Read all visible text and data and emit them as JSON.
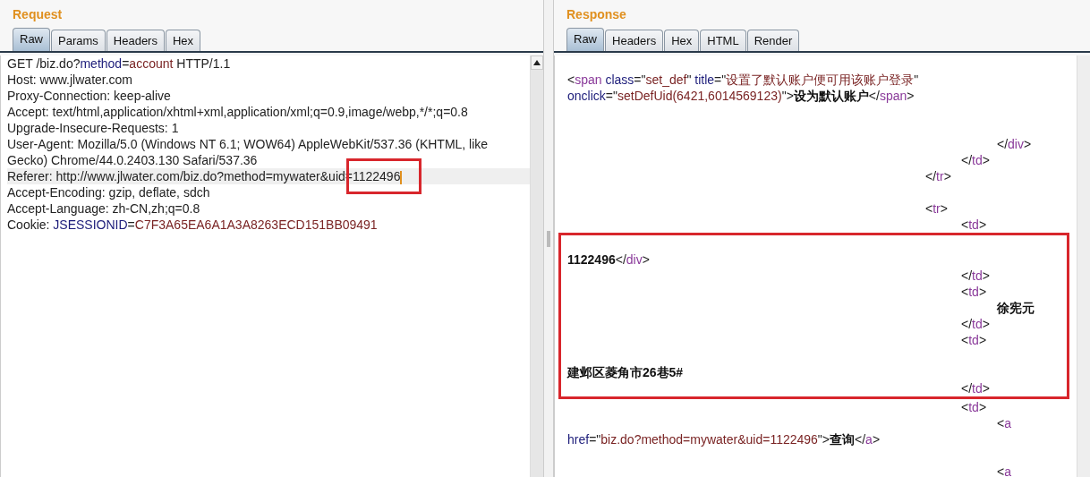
{
  "request": {
    "title": "Request",
    "tabs": [
      {
        "label": "Raw",
        "selected": true
      },
      {
        "label": "Params",
        "selected": false
      },
      {
        "label": "Headers",
        "selected": false
      },
      {
        "label": "Hex",
        "selected": false
      }
    ],
    "lines": [
      {
        "segments": [
          {
            "kind": "plain",
            "text": "GET /biz.do?"
          },
          {
            "kind": "name",
            "text": "method"
          },
          {
            "kind": "plain",
            "text": "="
          },
          {
            "kind": "value",
            "text": "account"
          },
          {
            "kind": "plain",
            "text": " HTTP/1.1"
          }
        ]
      },
      {
        "segments": [
          {
            "kind": "plain",
            "text": "Host: www.jlwater.com"
          }
        ]
      },
      {
        "segments": [
          {
            "kind": "plain",
            "text": "Proxy-Connection: keep-alive"
          }
        ]
      },
      {
        "segments": [
          {
            "kind": "plain",
            "text": "Accept: text/html,application/xhtml+xml,application/xml;q=0.9,image/webp,*/*;q=0.8"
          }
        ]
      },
      {
        "segments": [
          {
            "kind": "plain",
            "text": "Upgrade-Insecure-Requests: 1"
          }
        ]
      },
      {
        "segments": [
          {
            "kind": "plain",
            "text": "User-Agent: Mozilla/5.0 (Windows NT 6.1; WOW64) AppleWebKit/537.36 (KHTML, like"
          }
        ]
      },
      {
        "segments": [
          {
            "kind": "plain",
            "text": "Gecko) Chrome/44.0.2403.130 Safari/537.36"
          }
        ]
      },
      {
        "current": true,
        "cursor": true,
        "segments": [
          {
            "kind": "plain",
            "text": "Referer: http://www.jlwater.com/biz.do?method=mywater&uid"
          },
          {
            "kind": "boxed",
            "text": "=1122496"
          }
        ]
      },
      {
        "segments": [
          {
            "kind": "plain",
            "text": "Accept-Encoding: gzip, deflate, sdch"
          }
        ]
      },
      {
        "segments": [
          {
            "kind": "plain",
            "text": "Accept-Language: zh-CN,zh;q=0.8"
          }
        ]
      },
      {
        "segments": [
          {
            "kind": "plain",
            "text": "Cookie: "
          },
          {
            "kind": "name",
            "text": "JSESSIONID"
          },
          {
            "kind": "plain",
            "text": "="
          },
          {
            "kind": "value",
            "text": "C7F3A65EA6A1A3A8263ECD151BB09491"
          }
        ]
      }
    ]
  },
  "response": {
    "title": "Response",
    "tabs": [
      {
        "label": "Raw",
        "selected": true
      },
      {
        "label": "Headers",
        "selected": false
      },
      {
        "label": "Hex",
        "selected": false
      },
      {
        "label": "HTML",
        "selected": false
      },
      {
        "label": "Render",
        "selected": false
      }
    ],
    "blocks": [
      {
        "lines": [
          {
            "kind": "blank"
          },
          {
            "kind": "code",
            "segments": [
              {
                "kind": "plain",
                "text": "<"
              },
              {
                "kind": "tag",
                "text": "span"
              },
              {
                "kind": "name",
                "text": " class"
              },
              {
                "kind": "plain",
                "text": "=\""
              },
              {
                "kind": "value",
                "text": "set_def"
              },
              {
                "kind": "plain",
                "text": "\" "
              },
              {
                "kind": "name",
                "text": "title"
              },
              {
                "kind": "plain",
                "text": "=\""
              },
              {
                "kind": "value",
                "text": "设置了默认账户便可用该账户登录"
              },
              {
                "kind": "plain",
                "text": "\""
              }
            ]
          },
          {
            "kind": "code",
            "segments": [
              {
                "kind": "name",
                "text": "onclick"
              },
              {
                "kind": "plain",
                "text": "=\""
              },
              {
                "kind": "value",
                "text": "setDefUid(6421,6014569123)"
              },
              {
                "kind": "plain",
                "text": "\">"
              },
              {
                "kind": "bold",
                "text": "设为默认账户"
              },
              {
                "kind": "plain",
                "text": "</"
              },
              {
                "kind": "tag",
                "text": "span"
              },
              {
                "kind": "plain",
                "text": ">"
              }
            ]
          },
          {
            "kind": "blank"
          },
          {
            "kind": "blank"
          },
          {
            "kind": "code",
            "segments": [
              {
                "kind": "plain",
                "text": "\t\t\t\t\t\t\t\t\t\t\t\t</"
              },
              {
                "kind": "tag",
                "text": "div"
              },
              {
                "kind": "plain",
                "text": ">"
              }
            ]
          },
          {
            "kind": "code",
            "segments": [
              {
                "kind": "plain",
                "text": "\t\t\t\t\t\t\t\t\t\t\t</"
              },
              {
                "kind": "tag",
                "text": "td"
              },
              {
                "kind": "plain",
                "text": ">"
              }
            ]
          },
          {
            "kind": "code",
            "segments": [
              {
                "kind": "plain",
                "text": "\t\t\t\t\t\t\t\t\t\t</"
              },
              {
                "kind": "tag",
                "text": "tr"
              },
              {
                "kind": "plain",
                "text": ">"
              }
            ]
          },
          {
            "kind": "blank"
          },
          {
            "kind": "code",
            "segments": [
              {
                "kind": "plain",
                "text": "\t\t\t\t\t\t\t\t\t\t<"
              },
              {
                "kind": "tag",
                "text": "tr"
              },
              {
                "kind": "plain",
                "text": ">"
              }
            ]
          },
          {
            "kind": "code",
            "segments": [
              {
                "kind": "plain",
                "text": "\t\t\t\t\t\t\t\t\t\t\t<"
              },
              {
                "kind": "tag",
                "text": "td"
              },
              {
                "kind": "plain",
                "text": ">"
              }
            ]
          }
        ]
      },
      {
        "annotated": true,
        "lines": [
          {
            "kind": "blank"
          },
          {
            "kind": "code",
            "segments": [
              {
                "kind": "bold",
                "text": "1122496"
              },
              {
                "kind": "plain",
                "text": "</"
              },
              {
                "kind": "tag",
                "text": "div"
              },
              {
                "kind": "plain",
                "text": ">"
              }
            ]
          },
          {
            "kind": "code",
            "segments": [
              {
                "kind": "plain",
                "text": "\t\t\t\t\t\t\t\t\t\t\t</"
              },
              {
                "kind": "tag",
                "text": "td"
              },
              {
                "kind": "plain",
                "text": ">"
              }
            ]
          },
          {
            "kind": "code",
            "segments": [
              {
                "kind": "plain",
                "text": "\t\t\t\t\t\t\t\t\t\t\t<"
              },
              {
                "kind": "tag",
                "text": "td"
              },
              {
                "kind": "plain",
                "text": ">"
              }
            ]
          },
          {
            "kind": "code",
            "segments": [
              {
                "kind": "bold",
                "text": "\t\t\t\t\t\t\t\t\t\t\t\t徐宪元"
              }
            ]
          },
          {
            "kind": "code",
            "segments": [
              {
                "kind": "plain",
                "text": "\t\t\t\t\t\t\t\t\t\t\t</"
              },
              {
                "kind": "tag",
                "text": "td"
              },
              {
                "kind": "plain",
                "text": ">"
              }
            ]
          },
          {
            "kind": "code",
            "segments": [
              {
                "kind": "plain",
                "text": "\t\t\t\t\t\t\t\t\t\t\t<"
              },
              {
                "kind": "tag",
                "text": "td"
              },
              {
                "kind": "plain",
                "text": ">"
              }
            ]
          },
          {
            "kind": "blank"
          },
          {
            "kind": "code",
            "segments": [
              {
                "kind": "bold",
                "text": "建邺区菱角市26巷5#"
              }
            ]
          },
          {
            "kind": "code",
            "segments": [
              {
                "kind": "plain",
                "text": "\t\t\t\t\t\t\t\t\t\t\t</"
              },
              {
                "kind": "tag",
                "text": "td"
              },
              {
                "kind": "plain",
                "text": ">"
              }
            ]
          }
        ]
      },
      {
        "lines": [
          {
            "kind": "code",
            "segments": [
              {
                "kind": "plain",
                "text": "\t\t\t\t\t\t\t\t\t\t\t<"
              },
              {
                "kind": "tag",
                "text": "td"
              },
              {
                "kind": "plain",
                "text": ">"
              }
            ]
          },
          {
            "kind": "code",
            "segments": [
              {
                "kind": "plain",
                "text": "\t\t\t\t\t\t\t\t\t\t\t\t<"
              },
              {
                "kind": "tag",
                "text": "a"
              }
            ]
          },
          {
            "kind": "code",
            "segments": [
              {
                "kind": "name",
                "text": "href"
              },
              {
                "kind": "plain",
                "text": "=\""
              },
              {
                "kind": "value",
                "text": "biz.do?method=mywater&uid=1122496"
              },
              {
                "kind": "plain",
                "text": "\">"
              },
              {
                "kind": "bold",
                "text": "查询"
              },
              {
                "kind": "plain",
                "text": "</"
              },
              {
                "kind": "tag",
                "text": "a"
              },
              {
                "kind": "plain",
                "text": ">"
              }
            ]
          },
          {
            "kind": "blank"
          },
          {
            "kind": "code",
            "segments": [
              {
                "kind": "plain",
                "text": "\t\t\t\t\t\t\t\t\t\t\t\t<"
              },
              {
                "kind": "tag",
                "text": "a"
              }
            ]
          }
        ]
      }
    ]
  }
}
